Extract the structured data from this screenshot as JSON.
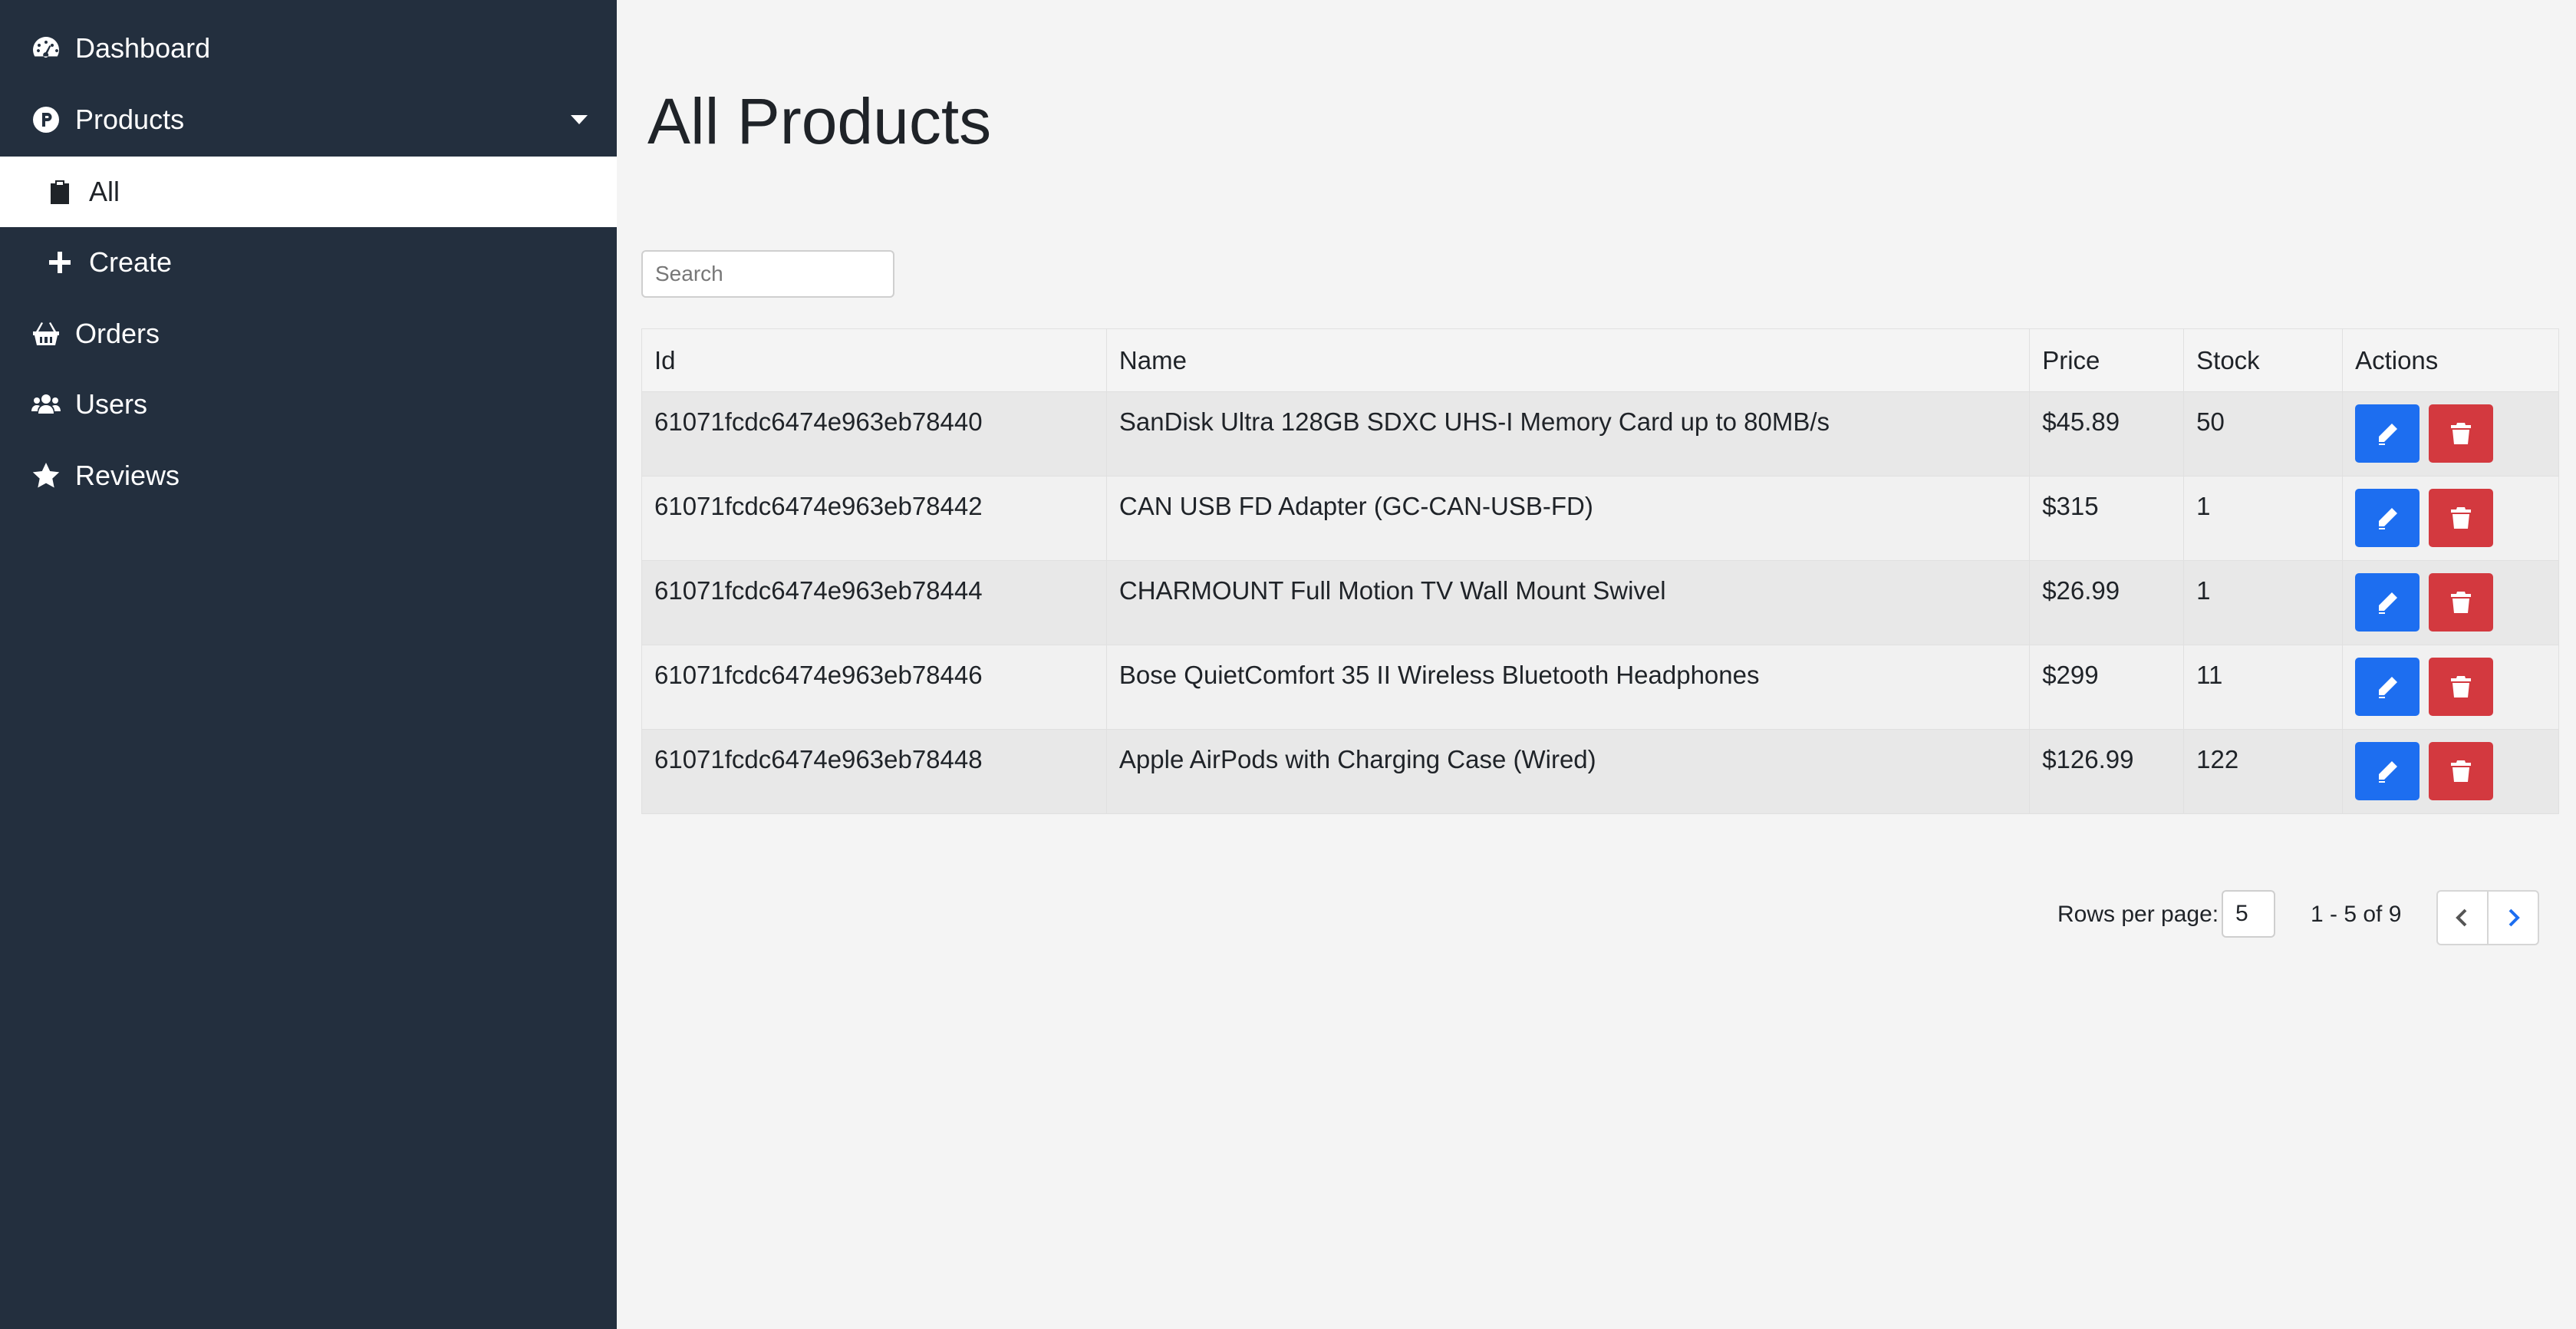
{
  "sidebar": {
    "items": [
      {
        "label": "Dashboard",
        "icon": "tachometer-icon"
      },
      {
        "label": "Products",
        "icon": "product-p-icon"
      },
      {
        "label": "All",
        "icon": "clipboard-icon"
      },
      {
        "label": "Create",
        "icon": "plus-icon"
      },
      {
        "label": "Orders",
        "icon": "shopping-basket-icon"
      },
      {
        "label": "Users",
        "icon": "users-icon"
      },
      {
        "label": "Reviews",
        "icon": "star-icon"
      }
    ]
  },
  "page": {
    "title": "All Products"
  },
  "search": {
    "placeholder": "Search",
    "value": ""
  },
  "table": {
    "headers": {
      "id": "Id",
      "name": "Name",
      "price": "Price",
      "stock": "Stock",
      "actions": "Actions"
    },
    "rows": [
      {
        "id": "61071fcdc6474e963eb78440",
        "name": "SanDisk Ultra 128GB SDXC UHS-I Memory Card up to 80MB/s",
        "price": "$45.89",
        "stock": "50"
      },
      {
        "id": "61071fcdc6474e963eb78442",
        "name": "CAN USB FD Adapter (GC-CAN-USB-FD)",
        "price": "$315",
        "stock": "1"
      },
      {
        "id": "61071fcdc6474e963eb78444",
        "name": "CHARMOUNT Full Motion TV Wall Mount Swivel",
        "price": "$26.99",
        "stock": "1"
      },
      {
        "id": "61071fcdc6474e963eb78446",
        "name": "Bose QuietComfort 35 II Wireless Bluetooth Headphones",
        "price": "$299",
        "stock": "11"
      },
      {
        "id": "61071fcdc6474e963eb78448",
        "name": "Apple AirPods with Charging Case (Wired)",
        "price": "$126.99",
        "stock": "122"
      }
    ]
  },
  "pagination": {
    "rows_per_page_label": "Rows per page:",
    "rows_per_page": "5",
    "range": "1 - 5 of 9"
  },
  "colors": {
    "sidebar_bg": "#232f3e",
    "edit": "#1d6ef0",
    "delete": "#d3393f",
    "page_bg": "#f4f4f4"
  }
}
